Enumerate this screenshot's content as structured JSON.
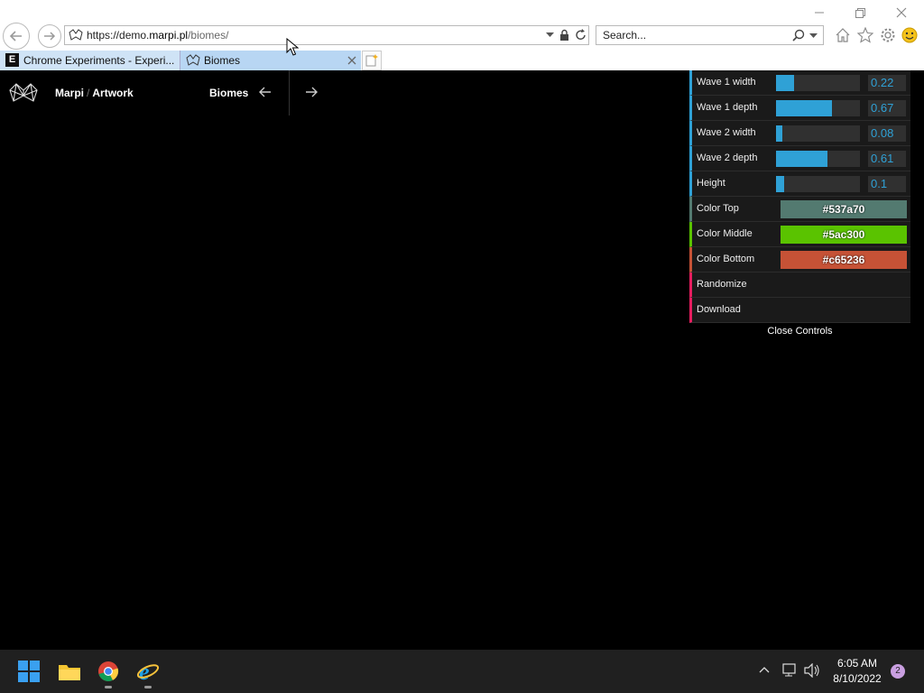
{
  "browser": {
    "address": {
      "host_prefix": "https://demo.",
      "host_main": "marpi.pl",
      "path": "/biomes/"
    },
    "search_placeholder": "Search...",
    "tabs": [
      {
        "label": "Chrome Experiments - Experi...",
        "favicon": "E"
      },
      {
        "label": "Biomes",
        "favicon": "marpi-logo"
      }
    ]
  },
  "site": {
    "crumb_parent": "Marpi",
    "crumb_sep": "/",
    "crumb_current": "Artwork",
    "project_title": "Biomes"
  },
  "controls": {
    "sliders": [
      {
        "label": "Wave 1 width",
        "value": "0.22",
        "fraction": 0.22
      },
      {
        "label": "Wave 1 depth",
        "value": "0.67",
        "fraction": 0.67
      },
      {
        "label": "Wave 2 width",
        "value": "0.08",
        "fraction": 0.08
      },
      {
        "label": "Wave 2 depth",
        "value": "0.61",
        "fraction": 0.61
      },
      {
        "label": "Height",
        "value": "0.1",
        "fraction": 0.1
      }
    ],
    "colors": [
      {
        "label": "Color Top",
        "value": "#537a70"
      },
      {
        "label": "Color Middle",
        "value": "#5ac300"
      },
      {
        "label": "Color Bottom",
        "value": "#c65236"
      }
    ],
    "functions": [
      {
        "label": "Randomize"
      },
      {
        "label": "Download"
      }
    ],
    "close_label": "Close Controls"
  },
  "taskbar": {
    "time": "6:05 AM",
    "date": "8/10/2022",
    "notification_count": "2"
  }
}
